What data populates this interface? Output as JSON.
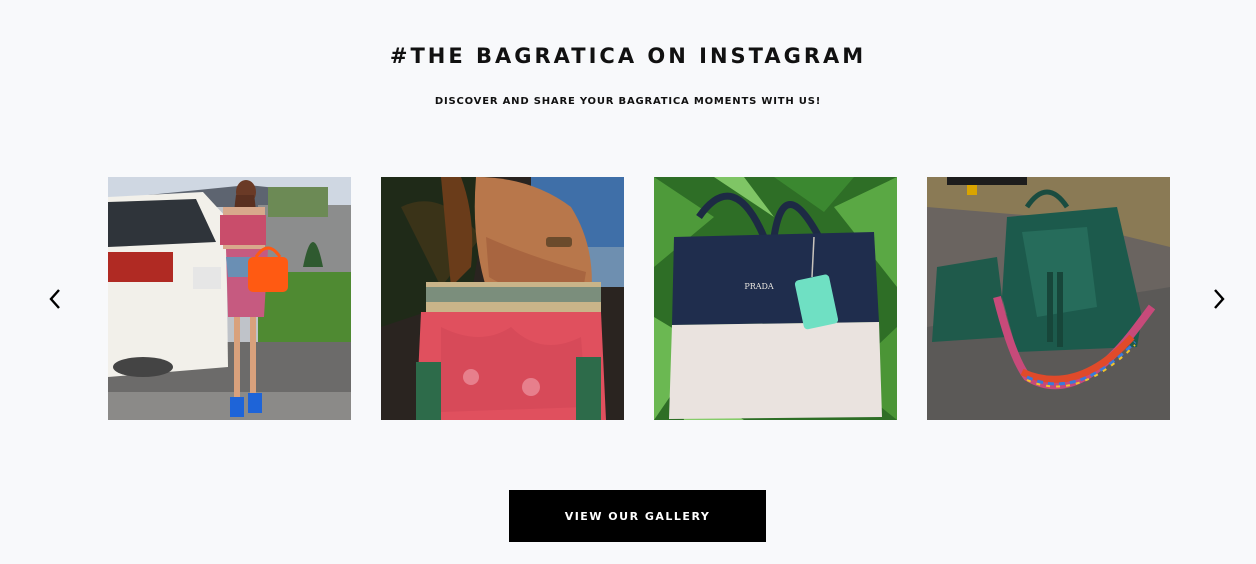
{
  "section": {
    "title": "#THE BAGRATICA ON INSTAGRAM",
    "subtitle": "DISCOVER AND SHARE YOUR BAGRATICA MOMENTS WITH US!"
  },
  "carousel": {
    "prev_icon": "chevron-left-icon",
    "next_icon": "chevron-right-icon",
    "photos": [
      {
        "subject": "woman-with-orange-bag-by-white-car-photo"
      },
      {
        "subject": "red-embroidered-tote-bag-photo"
      },
      {
        "subject": "navy-and-cream-prada-handbag-photo"
      },
      {
        "subject": "green-leather-bucket-bag-photo"
      }
    ]
  },
  "cta": {
    "label": "VIEW OUR GALLERY"
  },
  "colors": {
    "background": "#f8f9fb",
    "button": "#000000",
    "button_text": "#ffffff"
  }
}
